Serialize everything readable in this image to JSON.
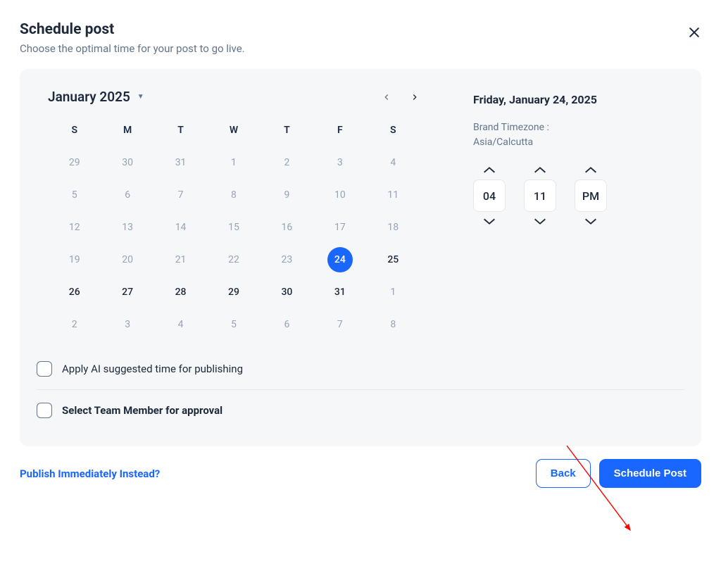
{
  "header": {
    "title": "Schedule post",
    "subtitle": "Choose the optimal time for your post to go live."
  },
  "calendar": {
    "month_label": "January 2025",
    "dow": [
      "S",
      "M",
      "T",
      "W",
      "T",
      "F",
      "S"
    ],
    "cells": [
      {
        "d": "29",
        "dim": true
      },
      {
        "d": "30",
        "dim": true
      },
      {
        "d": "31",
        "dim": true
      },
      {
        "d": "1",
        "dim": true
      },
      {
        "d": "2",
        "dim": true
      },
      {
        "d": "3",
        "dim": true
      },
      {
        "d": "4",
        "dim": true
      },
      {
        "d": "5",
        "dim": true
      },
      {
        "d": "6",
        "dim": true
      },
      {
        "d": "7",
        "dim": true
      },
      {
        "d": "8",
        "dim": true
      },
      {
        "d": "9",
        "dim": true
      },
      {
        "d": "10",
        "dim": true
      },
      {
        "d": "11",
        "dim": true
      },
      {
        "d": "12",
        "dim": true
      },
      {
        "d": "13",
        "dim": true
      },
      {
        "d": "14",
        "dim": true
      },
      {
        "d": "15",
        "dim": true
      },
      {
        "d": "16",
        "dim": true
      },
      {
        "d": "17",
        "dim": true
      },
      {
        "d": "18",
        "dim": true
      },
      {
        "d": "19",
        "dim": true
      },
      {
        "d": "20",
        "dim": true
      },
      {
        "d": "21",
        "dim": true
      },
      {
        "d": "22",
        "dim": true
      },
      {
        "d": "23",
        "dim": true
      },
      {
        "d": "24",
        "dim": false,
        "selected": true
      },
      {
        "d": "25",
        "dim": false
      },
      {
        "d": "26",
        "dim": false
      },
      {
        "d": "27",
        "dim": false
      },
      {
        "d": "28",
        "dim": false
      },
      {
        "d": "29",
        "dim": false
      },
      {
        "d": "30",
        "dim": false
      },
      {
        "d": "31",
        "dim": false
      },
      {
        "d": "1",
        "dim": true
      },
      {
        "d": "2",
        "dim": true
      },
      {
        "d": "3",
        "dim": true
      },
      {
        "d": "4",
        "dim": true
      },
      {
        "d": "5",
        "dim": true
      },
      {
        "d": "6",
        "dim": true
      },
      {
        "d": "7",
        "dim": true
      },
      {
        "d": "8",
        "dim": true
      }
    ]
  },
  "selected_date": "Friday, January 24, 2025",
  "timezone": {
    "label": "Brand Timezone :",
    "value": "Asia/Calcutta"
  },
  "time": {
    "hour": "04",
    "minute": "11",
    "meridiem": "PM"
  },
  "options": {
    "ai_suggested": "Apply AI suggested time for publishing",
    "team_approval": "Select Team Member for approval"
  },
  "footer": {
    "publish_link": "Publish Immediately Instead?",
    "back": "Back",
    "schedule": "Schedule Post"
  }
}
